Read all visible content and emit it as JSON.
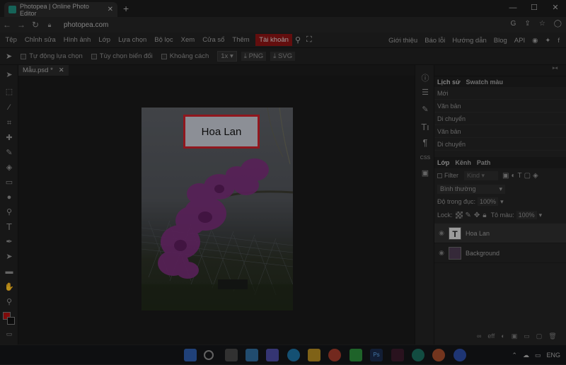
{
  "browser": {
    "tab_title": "Photopea | Online Photo Editor",
    "url": "photopea.com"
  },
  "menu": {
    "items": [
      "Tệp",
      "Chỉnh sửa",
      "Hình ảnh",
      "Lớp",
      "Lựa chọn",
      "Bộ lọc",
      "Xem",
      "Cửa sổ",
      "Thêm"
    ],
    "account": "Tài khoản",
    "right_items": [
      "Giới thiệu",
      "Báo lỗi",
      "Hướng dẫn",
      "Blog",
      "API"
    ]
  },
  "options": {
    "auto_select": "Tự động lựa chọn",
    "transform": "Tùy chọn biến đổi",
    "distances": "Khoảng cách",
    "zoom": "1x",
    "png": "PNG",
    "svg": "SVG"
  },
  "document": {
    "tab_name": "Mẫu.psd *",
    "text_layer_content": "Hoa Lan"
  },
  "history": {
    "tab_history": "Lịch sử",
    "tab_swatches": "Swatch màu",
    "items": [
      "Mới",
      "Văn bản",
      "Di chuyển",
      "Văn bản",
      "Di chuyển"
    ]
  },
  "layers_panel": {
    "tab_layers": "Lớp",
    "tab_channels": "Kênh",
    "tab_paths": "Path",
    "filter_label": "Filter",
    "kind": "Kind",
    "blend_mode": "Bình thường",
    "opacity_label": "Độ trong đục:",
    "opacity_value": "100%",
    "lock_label": "Lock:",
    "fill_label": "Tô màu:",
    "fill_value": "100%",
    "layers": [
      {
        "name": "Hoa Lan",
        "type": "text"
      },
      {
        "name": "Background",
        "type": "image"
      }
    ]
  },
  "taskbar": {
    "lang": "ENG"
  },
  "colors": {
    "accent_red": "#c8202a",
    "foreground_swatch": "#b01010"
  }
}
